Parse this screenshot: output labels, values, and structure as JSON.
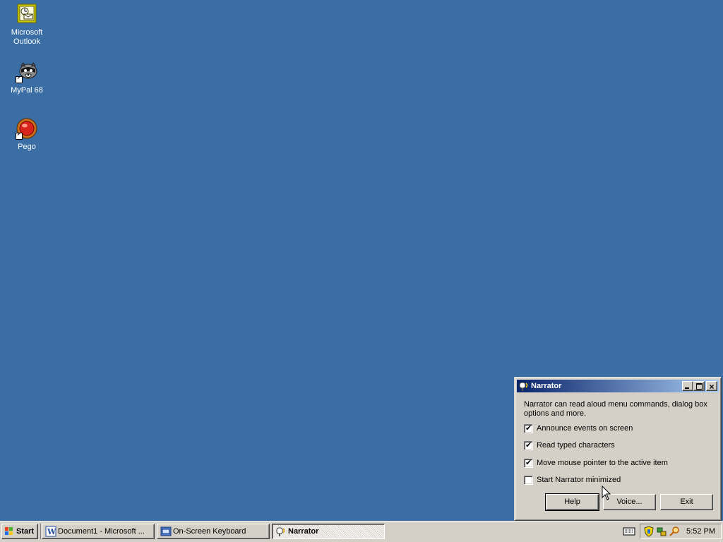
{
  "desktop": {
    "background": "#3a6ea5",
    "icons": [
      {
        "label_line1": "Microsoft",
        "label_line2": "Outlook",
        "icon": "outlook-icon"
      },
      {
        "label_line1": "MyPal 68",
        "label_line2": "",
        "icon": "raccoon-icon"
      },
      {
        "label_line1": "Pego",
        "label_line2": "",
        "icon": "pego-icon"
      }
    ]
  },
  "narrator": {
    "title": "Narrator",
    "description": "Narrator can read aloud menu commands, dialog box options and more.",
    "options": [
      {
        "label": "Announce events on screen",
        "checked": true
      },
      {
        "label": "Read typed characters",
        "checked": true
      },
      {
        "label": "Move mouse pointer to the active item",
        "checked": true
      },
      {
        "label": "Start Narrator minimized",
        "checked": false
      }
    ],
    "buttons": {
      "help": "Help",
      "voice": "Voice...",
      "exit": "Exit"
    }
  },
  "taskbar": {
    "start_label": "Start",
    "tasks": [
      {
        "label": "Document1 - Microsoft ...",
        "icon": "word-icon",
        "active": false
      },
      {
        "label": "On-Screen Keyboard",
        "icon": "keyboard-icon",
        "active": false
      },
      {
        "label": "Narrator",
        "icon": "narrator-icon",
        "active": true
      }
    ],
    "tray": {
      "clock": "5:52 PM"
    }
  }
}
